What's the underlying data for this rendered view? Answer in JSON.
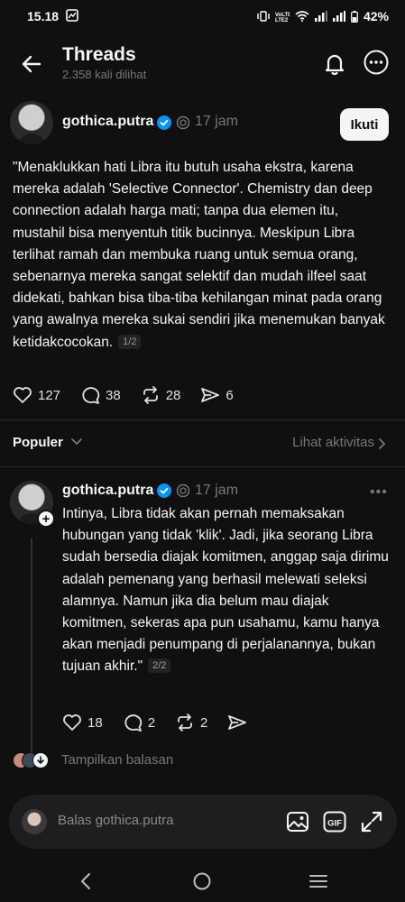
{
  "status_bar": {
    "time": "15.18",
    "battery": "42%"
  },
  "header": {
    "title": "Threads",
    "subtitle": "2.358 kali dilihat"
  },
  "post": {
    "username": "gothica.putra",
    "time": "17 jam",
    "follow_label": "Ikuti",
    "body": "\"Menaklukkan hati Libra itu butuh usaha ekstra, karena mereka adalah 'Selective Connector'. Chemistry dan deep connection adalah harga mati; tanpa dua elemen itu, mustahil bisa menyentuh titik bucinnya. Meskipun Libra terlihat ramah dan membuka ruang untuk semua orang, sebenarnya mereka sangat selektif dan mudah ilfeel saat didekati, bahkan bisa tiba-tiba kehilangan minat pada orang yang awalnya mereka sukai sendiri jika menemukan banyak ketidakcocokan.",
    "page_indicator": "1/2",
    "likes": "127",
    "replies": "38",
    "reposts": "28",
    "shares": "6"
  },
  "sort": {
    "label": "Populer",
    "activity_label": "Lihat aktivitas"
  },
  "reply": {
    "username": "gothica.putra",
    "time": "17 jam",
    "more_label": "•••",
    "body": "Intinya, Libra tidak akan pernah memaksakan hubungan yang tidak 'klik'. Jadi, jika seorang Libra sudah bersedia diajak komitmen, anggap saja dirimu adalah pemenang yang berhasil melewati seleksi alamnya. Namun jika dia belum mau diajak komitmen, sekeras apa pun usahamu, kamu hanya akan menjadi penumpang di perjalanannya, bukan tujuan akhir.\"",
    "page_indicator": "2/2",
    "likes": "18",
    "replies": "2",
    "reposts": "2",
    "show_replies_label": "Tampilkan balasan"
  },
  "composer": {
    "placeholder": "Balas gothica.putra"
  },
  "icons": [
    "back-arrow-icon",
    "bell-icon",
    "more-icon",
    "verified-icon",
    "clock-icon",
    "heart-icon",
    "comment-icon",
    "repost-icon",
    "share-icon",
    "chevron-down-icon",
    "chevron-right-icon",
    "image-icon",
    "gif-icon",
    "expand-icon",
    "nav-back-icon",
    "nav-home-icon",
    "nav-menu-icon"
  ],
  "colors": {
    "background": "#101010",
    "text": "#f3f5f7",
    "muted": "#777777",
    "verified": "#0095f6",
    "composer": "#1e1e1e"
  }
}
